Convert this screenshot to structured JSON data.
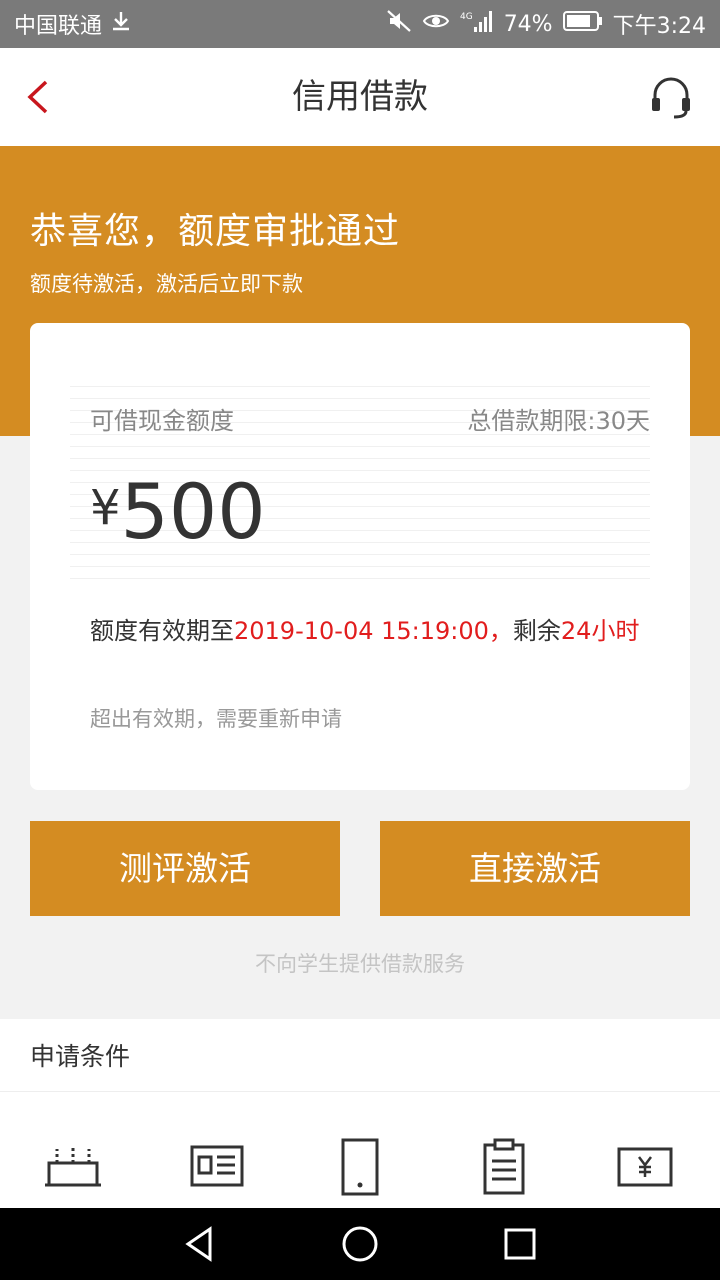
{
  "status_bar": {
    "carrier": "中国联通",
    "battery": "74%",
    "time": "下午3:24"
  },
  "header": {
    "title": "信用借款",
    "back_icon": "chevron-left-icon",
    "service_icon": "headset-icon"
  },
  "banner": {
    "title": "恭喜您，额度审批通过",
    "subtitle": "额度待激活，激活后立即下款"
  },
  "card": {
    "quota_label": "可借现金额度",
    "term_label": "总借款期限:30天",
    "currency": "¥",
    "amount": "500",
    "validity_prefix": "额度有效期至",
    "validity_date": "2019-10-04 15:19:00，",
    "validity_remaining_label": "剩余",
    "validity_remaining": "24小时",
    "expire_note": "超出有效期，需要重新申请"
  },
  "actions": {
    "evaluate_label": "测评激活",
    "direct_label": "直接激活"
  },
  "notice": "不向学生提供借款服务",
  "conditions": {
    "title": "申请条件",
    "icons": [
      "router-icon",
      "id-card-icon",
      "phone-icon",
      "clipboard-icon",
      "bank-card-icon"
    ]
  },
  "colors": {
    "accent": "#d48c22",
    "highlight": "#e11d1d"
  }
}
